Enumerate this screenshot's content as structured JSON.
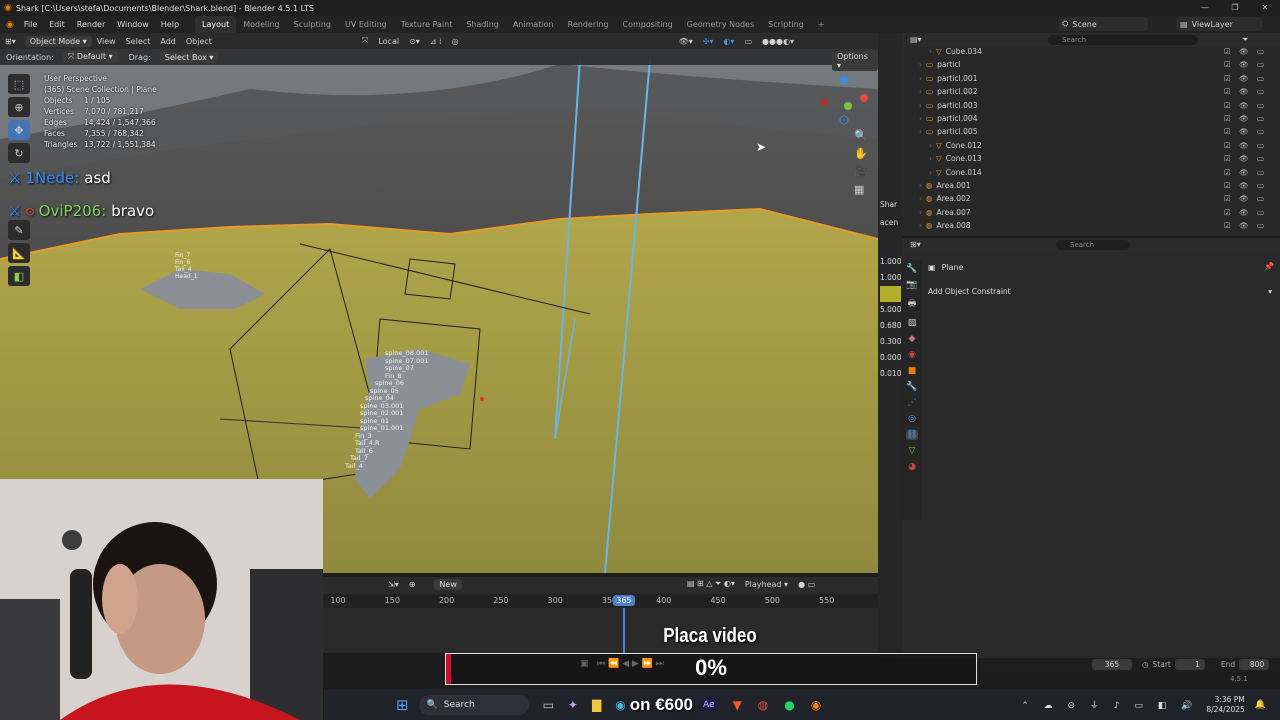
{
  "window": {
    "title": "Shark [C:\\Users\\stefa\\Documents\\Blender\\Shark.blend] - Blender 4.5.1 LTS"
  },
  "menu": [
    "File",
    "Edit",
    "Render",
    "Window",
    "Help"
  ],
  "workspaces": [
    "Layout",
    "Modeling",
    "Sculpting",
    "UV Editing",
    "Texture Paint",
    "Shading",
    "Animation",
    "Rendering",
    "Compositing",
    "Geometry Nodes",
    "Scripting"
  ],
  "active_workspace": "Layout",
  "scene": {
    "label": "Scene",
    "viewlayer": "ViewLayer"
  },
  "viewport_header": {
    "mode": "Object Mode",
    "view": "View",
    "select": "Select",
    "add": "Add",
    "object": "Object",
    "transform": "Local"
  },
  "tool_settings": {
    "orientation_label": "Orientation:",
    "orientation_value": "Default",
    "drag_label": "Drag:",
    "drag_value": "Select Box",
    "options": "Options"
  },
  "stats": {
    "perspective": "User Perspective",
    "collection": "(365) Scene Collection | Plane",
    "objects_label": "Objects",
    "objects_value": "1 / 105",
    "vertices_label": "Vertices",
    "vertices_value": "7,070 / 781,217",
    "edges_label": "Edges",
    "edges_value": "14,424 / 1,547,366",
    "faces_label": "Faces",
    "faces_value": "7,355 / 768,342",
    "triangles_label": "Triangles",
    "triangles_value": "13,722 / 1,551,384"
  },
  "chat": [
    {
      "user": "1Nede:",
      "message": "asd",
      "user_color": "#2f8cff"
    },
    {
      "user": "OviP206:",
      "message": "bravo",
      "user_color": "#7fd35a"
    }
  ],
  "bone_labels": [
    "Fin_7",
    "Fin_6",
    "Tail_4",
    "Head_1",
    "spine_08.001",
    "spine_07.001",
    "spine_07",
    "Fin_8",
    "spine_06",
    "spine_05",
    "spine_04",
    "spine_03.001",
    "spine_02.001",
    "spine_01",
    "spine_01.001",
    "Fin_3",
    "Tail_4.R",
    "Tail_6",
    "Tail_7",
    "Tail_4"
  ],
  "side_values": [
    "1.000",
    "1.000",
    "1.000",
    "5.000",
    "0.680",
    "0.300",
    "0.000",
    "0.010"
  ],
  "side_label_shar": "Shar",
  "side_label_acen": "acen",
  "timeline": {
    "new_label": "New",
    "playhead_label": "Playhead",
    "ticks": [
      "100",
      "150",
      "200",
      "250",
      "300",
      "350",
      "400",
      "450",
      "500",
      "550"
    ],
    "current_frame": "365",
    "start_label": "Start",
    "start_value": "1",
    "end_label": "End",
    "end_value": "800"
  },
  "outliner": {
    "search_placeholder": "Search",
    "rows": [
      {
        "name": "Cube.034",
        "indent": 2
      },
      {
        "name": "particl",
        "indent": 1
      },
      {
        "name": "particl.001",
        "indent": 1
      },
      {
        "name": "particl.002",
        "indent": 1
      },
      {
        "name": "particl.003",
        "indent": 1
      },
      {
        "name": "particl.004",
        "indent": 1
      },
      {
        "name": "particl.005",
        "indent": 1
      },
      {
        "name": "Cone.012",
        "indent": 2
      },
      {
        "name": "Cone.013",
        "indent": 2
      },
      {
        "name": "Cone.014",
        "indent": 2
      },
      {
        "name": "Area.001",
        "indent": 1
      },
      {
        "name": "Area.002",
        "indent": 1
      },
      {
        "name": "Area.007",
        "indent": 1
      },
      {
        "name": "Area.008",
        "indent": 1
      }
    ]
  },
  "properties": {
    "search_placeholder": "Search",
    "object_name": "Plane",
    "add_constraint": "Add Object Constraint"
  },
  "overlay": {
    "title": "Placa video",
    "percent": "0%",
    "progress": 0.01
  },
  "taskbar": {
    "search": "Search",
    "price": "on €600",
    "time": "3:36 PM",
    "date": "8/24/2025"
  },
  "version": "4.5.1"
}
